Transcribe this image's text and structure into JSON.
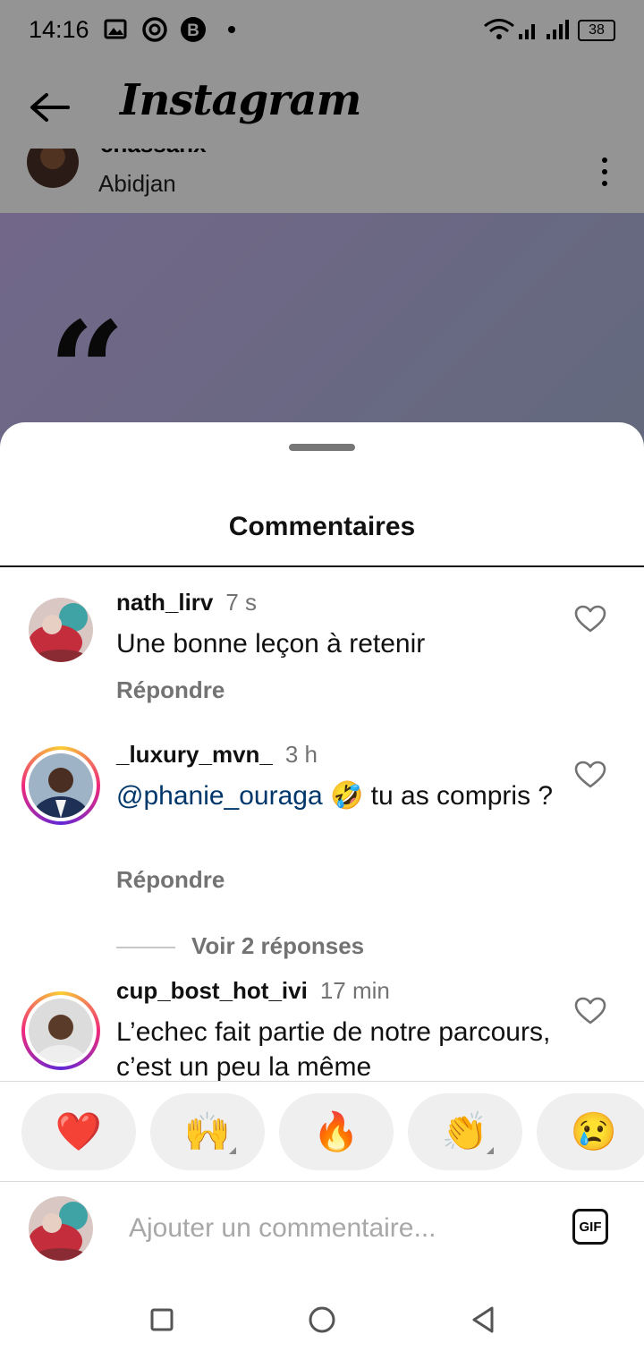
{
  "status_bar": {
    "time": "14:16",
    "battery": "38"
  },
  "app": {
    "brand": "Instagram"
  },
  "post": {
    "username": "cnassanx",
    "location": "Abidjan",
    "quote_glyph": "“"
  },
  "sheet": {
    "title": "Commentaires"
  },
  "comments": [
    {
      "username": "nath_lirv",
      "time": "7 s",
      "text": "Une bonne leçon à retenir",
      "reply_label": "Répondre"
    },
    {
      "username": "_luxury_mvn_",
      "time": "3 h",
      "mention": "@phanie_ouraga",
      "emoji": "🤣",
      "text": " tu as compris ?",
      "reply_label": "Répondre",
      "view_replies": "Voir 2 réponses"
    },
    {
      "username": "cup_bost_hot_ivi",
      "time": "17 min",
      "text": "L’echec fait partie de notre parcours, c’est un peu la même"
    }
  ],
  "reactions": [
    "❤️",
    "🙌",
    "🔥",
    "👏",
    "😢"
  ],
  "composer": {
    "placeholder": "Ajouter un commentaire...",
    "gif_label": "GIF"
  },
  "colors": {
    "mention": "#00376b",
    "heart_reaction": "#ed1c24",
    "secondary_text": "#737373"
  }
}
